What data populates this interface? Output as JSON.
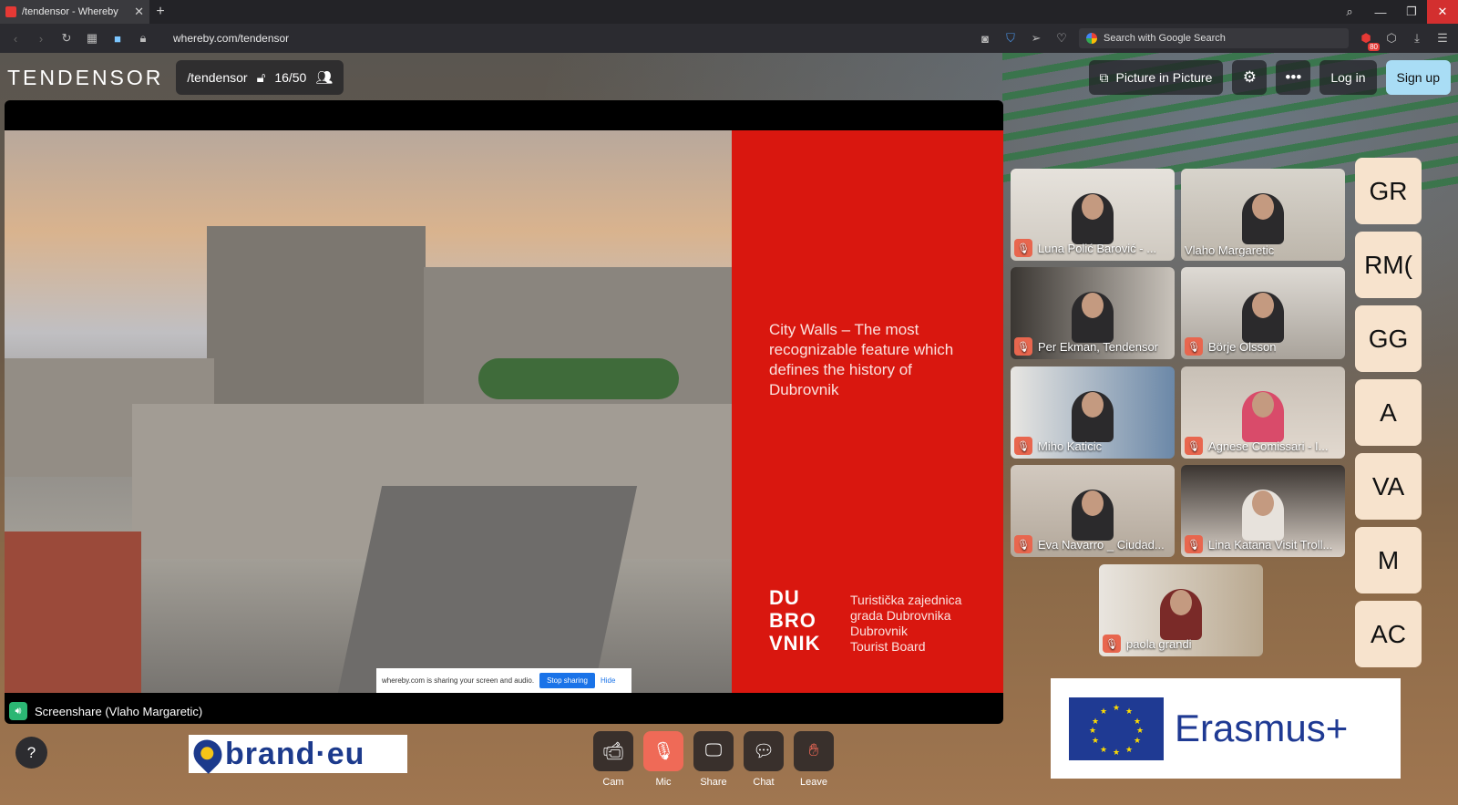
{
  "browser": {
    "tab_title": "/tendensor - Whereby",
    "new_tab": "+",
    "url": "whereby.com/tendensor",
    "search_placeholder": "Search with Google Search",
    "extension_badge": "80"
  },
  "topbar": {
    "logo": "TENDENSOR",
    "room": "/tendensor",
    "capacity": "16/50",
    "pip_label": "Picture in Picture",
    "login_label": "Log in",
    "signup_label": "Sign up"
  },
  "screenshare": {
    "slide_caption": "City Walls – The most recognizable feature which defines the history of Dubrovnik",
    "logo_lines": [
      "DU",
      "BRO",
      "VNIK"
    ],
    "board_line1": "Turistička zajednica",
    "board_line2": "grada Dubrovnika",
    "board_line3": "Dubrovnik",
    "board_line4": "Tourist Board",
    "notice_text": "whereby.com is sharing your screen and audio.",
    "stop_label": "Stop sharing",
    "hide_label": "Hide",
    "label": "Screenshare (Vlaho Margaretic)"
  },
  "participants": [
    {
      "name": "Luna Polić Barović - ...",
      "muted": true
    },
    {
      "name": "Vlaho Margaretic",
      "muted": false
    },
    {
      "name": "Per Ekman, Tendensor",
      "muted": true
    },
    {
      "name": "Börje Olsson",
      "muted": true
    },
    {
      "name": "Miho Katicic",
      "muted": true
    },
    {
      "name": "Agnese Comissari - I...",
      "muted": true
    },
    {
      "name": "Eva Navarro _ Ciudad...",
      "muted": true
    },
    {
      "name": "Lina Katana Visit Troll...",
      "muted": true
    },
    {
      "name": "paola grandi",
      "muted": true
    }
  ],
  "avatars": [
    "GR",
    "RM(",
    "GG",
    "A",
    "VA",
    "M",
    "AC"
  ],
  "controls": {
    "cam": "Cam",
    "mic": "Mic",
    "share": "Share",
    "chat": "Chat",
    "leave": "Leave"
  },
  "help_label": "?",
  "brand_text": "brand·eu",
  "erasmus_text": "Erasmus+",
  "colors": {
    "accent_signup": "#a9ddf5",
    "mute_red": "#e8664e",
    "slide_red": "#d9170f",
    "avatar_bg": "#f7e3cd"
  }
}
